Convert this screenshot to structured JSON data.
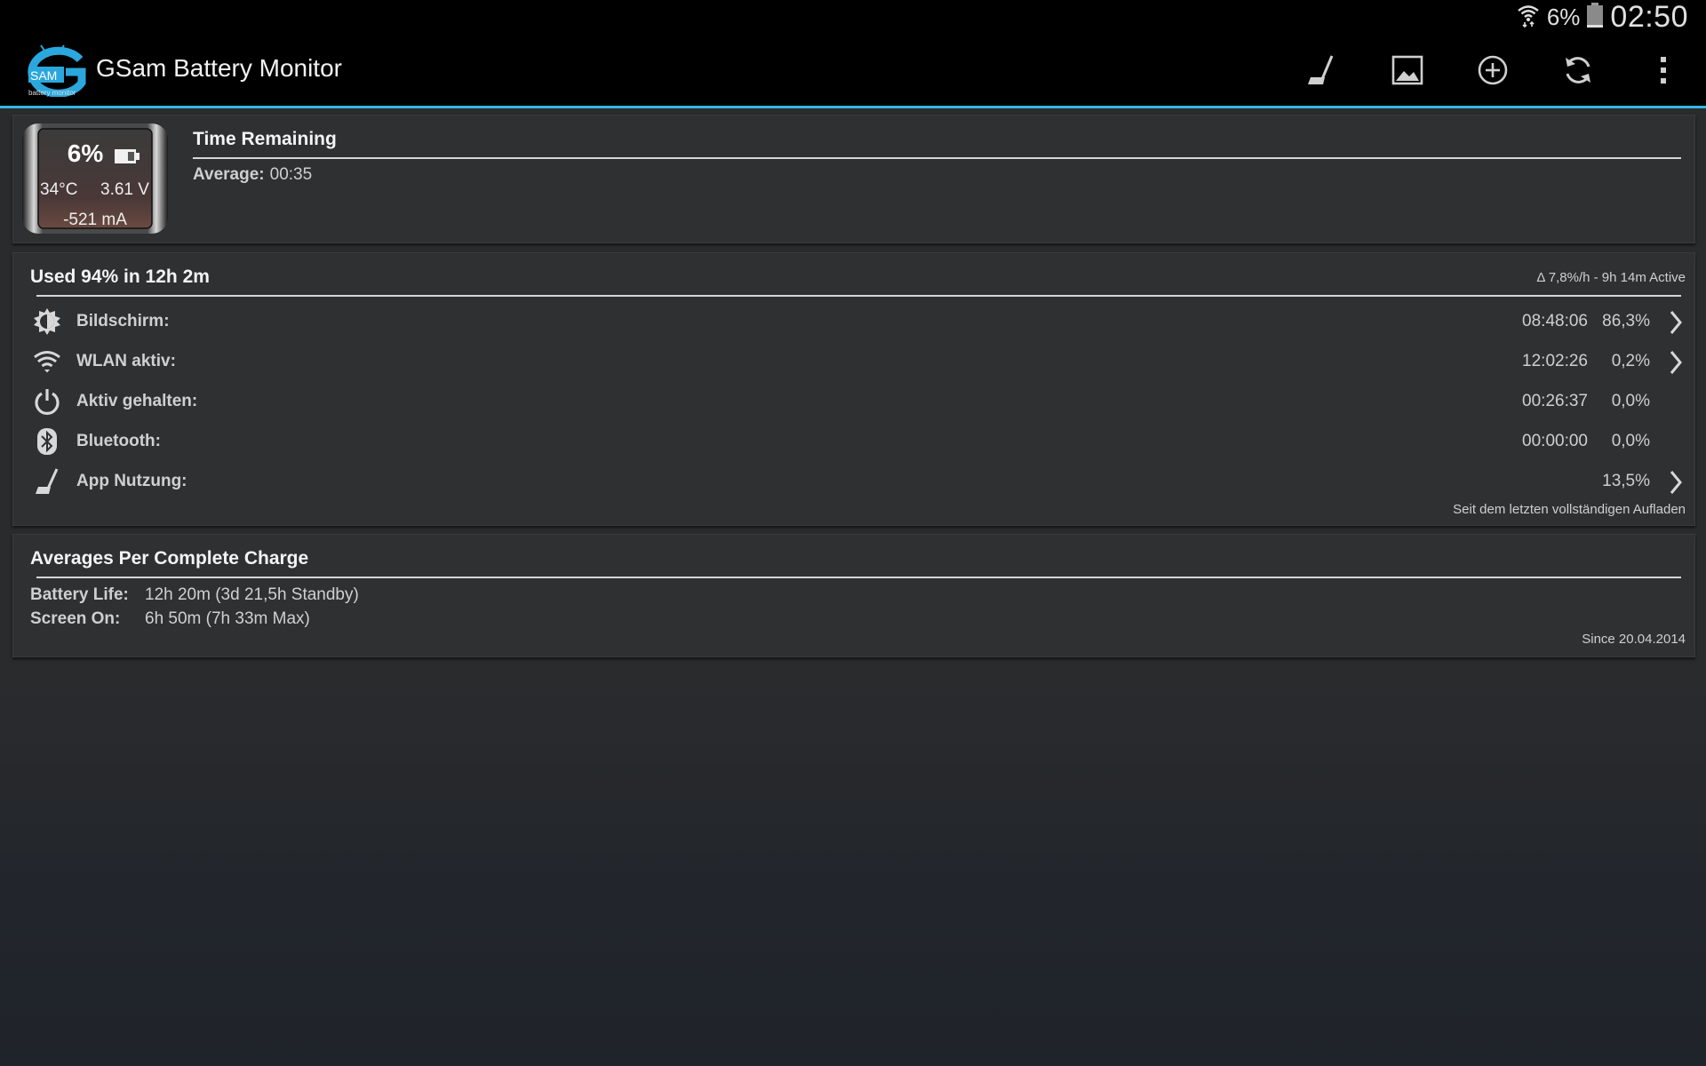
{
  "status_bar": {
    "battery_percent": "6%",
    "time": "02:50",
    "icons": [
      "wifi-icon",
      "battery-icon"
    ]
  },
  "action_bar": {
    "logo_text": "SAM",
    "logo_subtext": "battery monitor",
    "title": "GSam Battery Monitor",
    "actions": [
      "broom-icon",
      "image-icon",
      "add-circle-icon",
      "refresh-icon",
      "overflow-menu-icon"
    ],
    "accent_color": "#33b5e5"
  },
  "time_remaining": {
    "battery_percent": "6%",
    "temperature": "34°C",
    "voltage": "3.61 V",
    "current": "-521 mA",
    "title": "Time Remaining",
    "average_label": "Average:",
    "average_value": "00:35"
  },
  "usage": {
    "title": "Used 94% in 12h 2m",
    "rate_note": "Δ 7,8%/h - 9h 14m Active",
    "rows": [
      {
        "icon": "brightness-icon",
        "label": "Bildschirm:",
        "time": "08:48:06",
        "percent": "86,3%",
        "has_arrow": true
      },
      {
        "icon": "wifi-icon",
        "label": "WLAN aktiv:",
        "time": "12:02:26",
        "percent": "0,2%",
        "has_arrow": true
      },
      {
        "icon": "power-icon",
        "label": "Aktiv gehalten:",
        "time": "00:26:37",
        "percent": "0,0%",
        "has_arrow": false
      },
      {
        "icon": "bluetooth-icon",
        "label": "Bluetooth:",
        "time": "00:00:00",
        "percent": "0,0%",
        "has_arrow": false
      },
      {
        "icon": "broom-icon",
        "label": "App Nutzung:",
        "time": "",
        "percent": "13,5%",
        "has_arrow": true
      }
    ],
    "footer": "Seit dem letzten vollständigen Aufladen"
  },
  "averages": {
    "title": "Averages Per Complete Charge",
    "battery_life_label": "Battery Life:",
    "battery_life_value": "12h 20m (3d 21,5h Standby)",
    "screen_on_label": "Screen On:",
    "screen_on_value": "6h 50m (7h 33m Max)",
    "footer": "Since 20.04.2014"
  }
}
